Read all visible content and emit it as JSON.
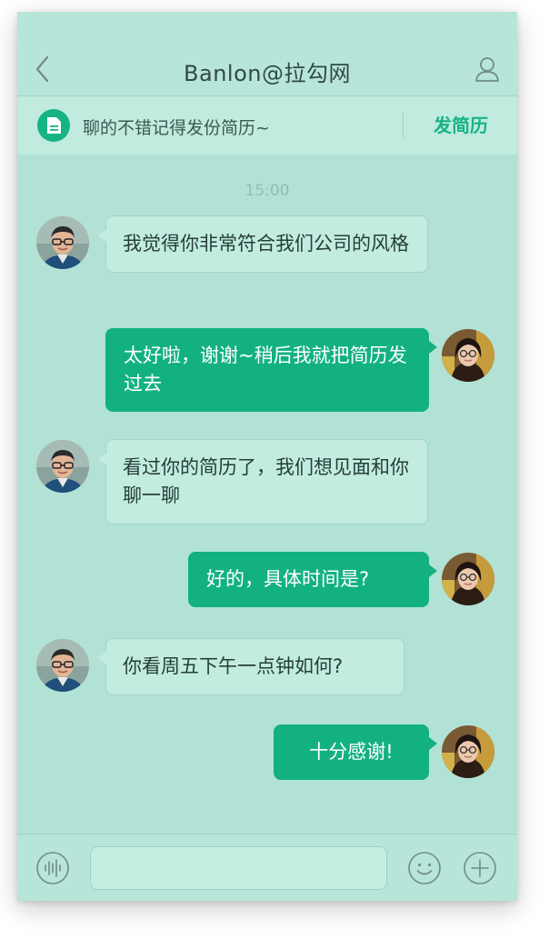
{
  "header": {
    "title": "Banlon@拉勾网",
    "back_icon": "chevron-left-icon",
    "profile_icon": "user-icon"
  },
  "resume_bar": {
    "icon": "document-icon",
    "text": "聊的不错记得发份简历~",
    "button_label": "发简历"
  },
  "chat": {
    "timestamp": "15:00",
    "messages": [
      {
        "from": "recruiter",
        "text": "我觉得你非常符合我们公司的风格"
      },
      {
        "from": "me",
        "text": "太好啦，谢谢~稍后我就把简历发过去"
      },
      {
        "from": "recruiter",
        "text": "看过你的简历了，我们想见面和你聊一聊"
      },
      {
        "from": "me",
        "text": "好的，具体时间是?"
      },
      {
        "from": "recruiter",
        "text": "你看周五下午一点钟如何?"
      },
      {
        "from": "me",
        "text": "十分感谢!"
      }
    ]
  },
  "input_bar": {
    "voice_icon": "voice-wave-icon",
    "input_value": "",
    "emoji_icon": "smile-icon",
    "more_icon": "plus-circle-icon"
  },
  "colors": {
    "accent": "#13b182",
    "background": "#b2e2d5",
    "incoming_bubble": "#c2ece0"
  }
}
